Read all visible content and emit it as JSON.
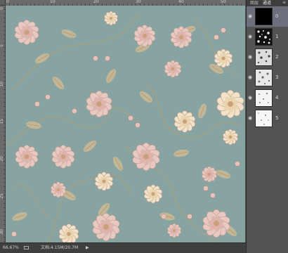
{
  "ruler": {
    "top_labels": [
      "0",
      "5",
      "10",
      "15",
      "20",
      "25",
      "30",
      "35",
      "40",
      "45",
      "50",
      "55",
      "60",
      "65"
    ],
    "left_labels": [
      "0",
      "5",
      "10",
      "15",
      "20",
      "25",
      "30",
      "35",
      "40",
      "45",
      "50",
      "55",
      "60",
      "65"
    ]
  },
  "status": {
    "zoom": "66.67%",
    "doc_info": "文档:4.15M/20.7M",
    "arrow": "▶"
  },
  "panel": {
    "tabs": [
      "图层",
      "通道"
    ],
    "menu_icon": "≡",
    "channels": [
      {
        "number": "0",
        "eye": "👁",
        "thumb": "black"
      },
      {
        "number": "1",
        "eye": "👁",
        "thumb": "dark-speckle"
      },
      {
        "number": "2",
        "eye": "👁",
        "thumb": "light-speckle"
      },
      {
        "number": "3",
        "eye": "👁",
        "thumb": "light-speckle"
      },
      {
        "number": "4",
        "eye": "👁",
        "thumb": "white-speckle"
      },
      {
        "number": "5",
        "eye": "👁",
        "thumb": "white-speckle"
      }
    ]
  },
  "colors": {
    "canvas_bg": "#87a4a2",
    "flower_pink": "#e7c9c2",
    "flower_core": "#caa07a",
    "leaf": "#c9b895",
    "selected_row": "#6d6f7c"
  }
}
